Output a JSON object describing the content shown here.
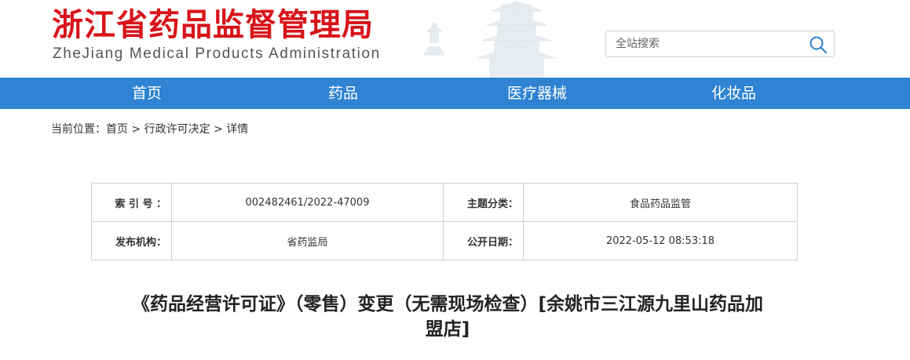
{
  "header": {
    "title": "浙江省药品监督管理局",
    "subtitle": "ZheJiang Medical Products Administration",
    "search": {
      "placeholder": "全站搜索"
    }
  },
  "nav": {
    "items": [
      {
        "label": "首页"
      },
      {
        "label": "药品"
      },
      {
        "label": "医疗器械"
      },
      {
        "label": "化妆品"
      }
    ]
  },
  "breadcrumb": {
    "prefix": "当前位置：",
    "items": [
      "首页",
      "行政许可决定",
      "详情"
    ],
    "separator": ">"
  },
  "meta": {
    "index_label": "索 引 号 ：",
    "index_value": "002482461/2022-47009",
    "category_label": "主题分类：",
    "category_value": "食品药品监管",
    "publisher_label": "发布机构：",
    "publisher_value": "省药监局",
    "date_label": "公开日期：",
    "date_value": "2022-05-12 08:53:18"
  },
  "document": {
    "title_line1": "《药品经营许可证》（零售）变更（无需现场检查）[余姚市三江源九里山药品加",
    "title_line2": "盟店]"
  },
  "colors": {
    "title_red": "#d7141a",
    "nav_blue": "#2f83d2",
    "search_icon": "#2f83d2"
  },
  "icons": {
    "search": "search-icon",
    "pagoda": "pagoda-illustration"
  }
}
